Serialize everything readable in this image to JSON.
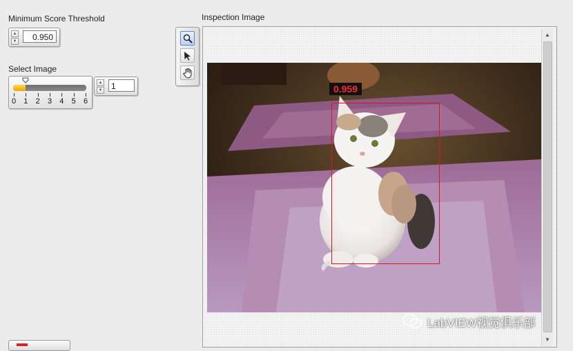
{
  "min_score": {
    "label": "Minimum Score Threshold",
    "value": "0.950"
  },
  "select_image": {
    "label": "Select Image",
    "ticks": [
      "0",
      "1",
      "2",
      "3",
      "4",
      "5",
      "6"
    ],
    "value": "1",
    "slider_fraction": 0.1667
  },
  "inspection": {
    "label": "Inspection Image"
  },
  "tools": [
    "zoom-icon",
    "pointer-icon",
    "pan-hand-icon"
  ],
  "detection": {
    "score": "0.959",
    "box_color": "#e0141e",
    "score_color": "#ff2a2a"
  },
  "watermark": {
    "text": "LabVIEW视觉俱乐部"
  },
  "colors": {
    "slider_fill": "#f0a800",
    "background": "#ececec"
  }
}
